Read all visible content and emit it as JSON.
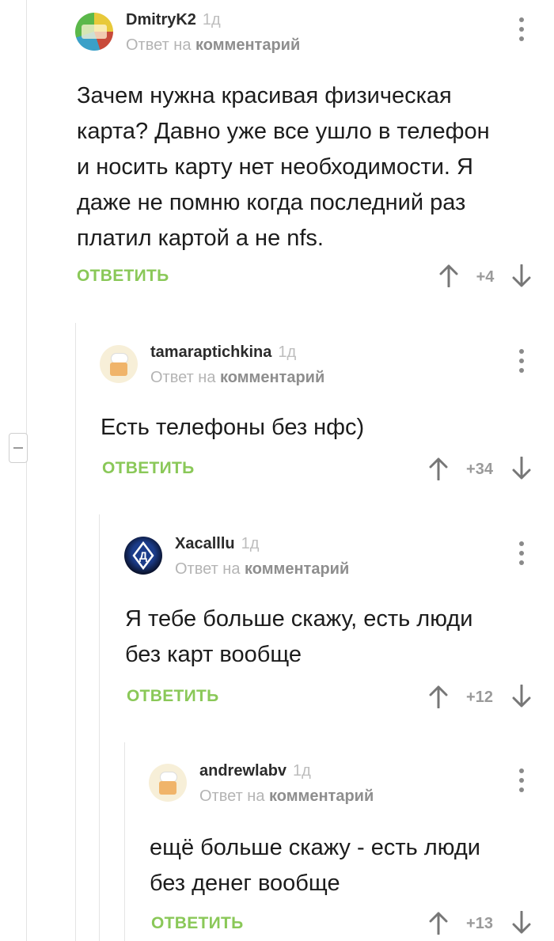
{
  "comments": [
    {
      "author": "DmitryK2",
      "age": "1д",
      "reply_prefix": "Ответ на",
      "reply_target": "комментарий",
      "text_lines": [
        "Зачем нужна красивая физическая",
        "карта? Давно уже все ушло в телефон",
        "и носить карту нет необходимости. Я",
        "даже не помню когда последний раз",
        "платил картой а не nfs."
      ],
      "reply_label": "ОТВЕТИТЬ",
      "score": "+4"
    },
    {
      "author": "tamaraptichkina",
      "age": "1д",
      "reply_prefix": "Ответ на",
      "reply_target": "комментарий",
      "text_lines": [
        "Есть телефоны без нфс)"
      ],
      "reply_label": "ОТВЕТИТЬ",
      "score": "+34"
    },
    {
      "author": "Xacalllu",
      "age": "1д",
      "reply_prefix": "Ответ на",
      "reply_target": "комментарий",
      "text_lines": [
        "Я тебе больше скажу, есть люди",
        "без карт вообще"
      ],
      "reply_label": "ОТВЕТИТЬ",
      "score": "+12"
    },
    {
      "author": "andrewlabv",
      "age": "1д",
      "reply_prefix": "Ответ на",
      "reply_target": "комментарий",
      "text_lines": [
        "ещё больше скажу - есть люди",
        "без денег вообще"
      ],
      "reply_label": "ОТВЕТИТЬ",
      "score": "+13"
    }
  ],
  "colors": {
    "accent_green": "#8ac858",
    "muted_text": "#b4b4b4",
    "thread_line": "#e4e4e4"
  },
  "icons": [
    "collapse-minus-icon",
    "more-vertical-icon",
    "arrow-up-icon",
    "arrow-down-icon"
  ]
}
